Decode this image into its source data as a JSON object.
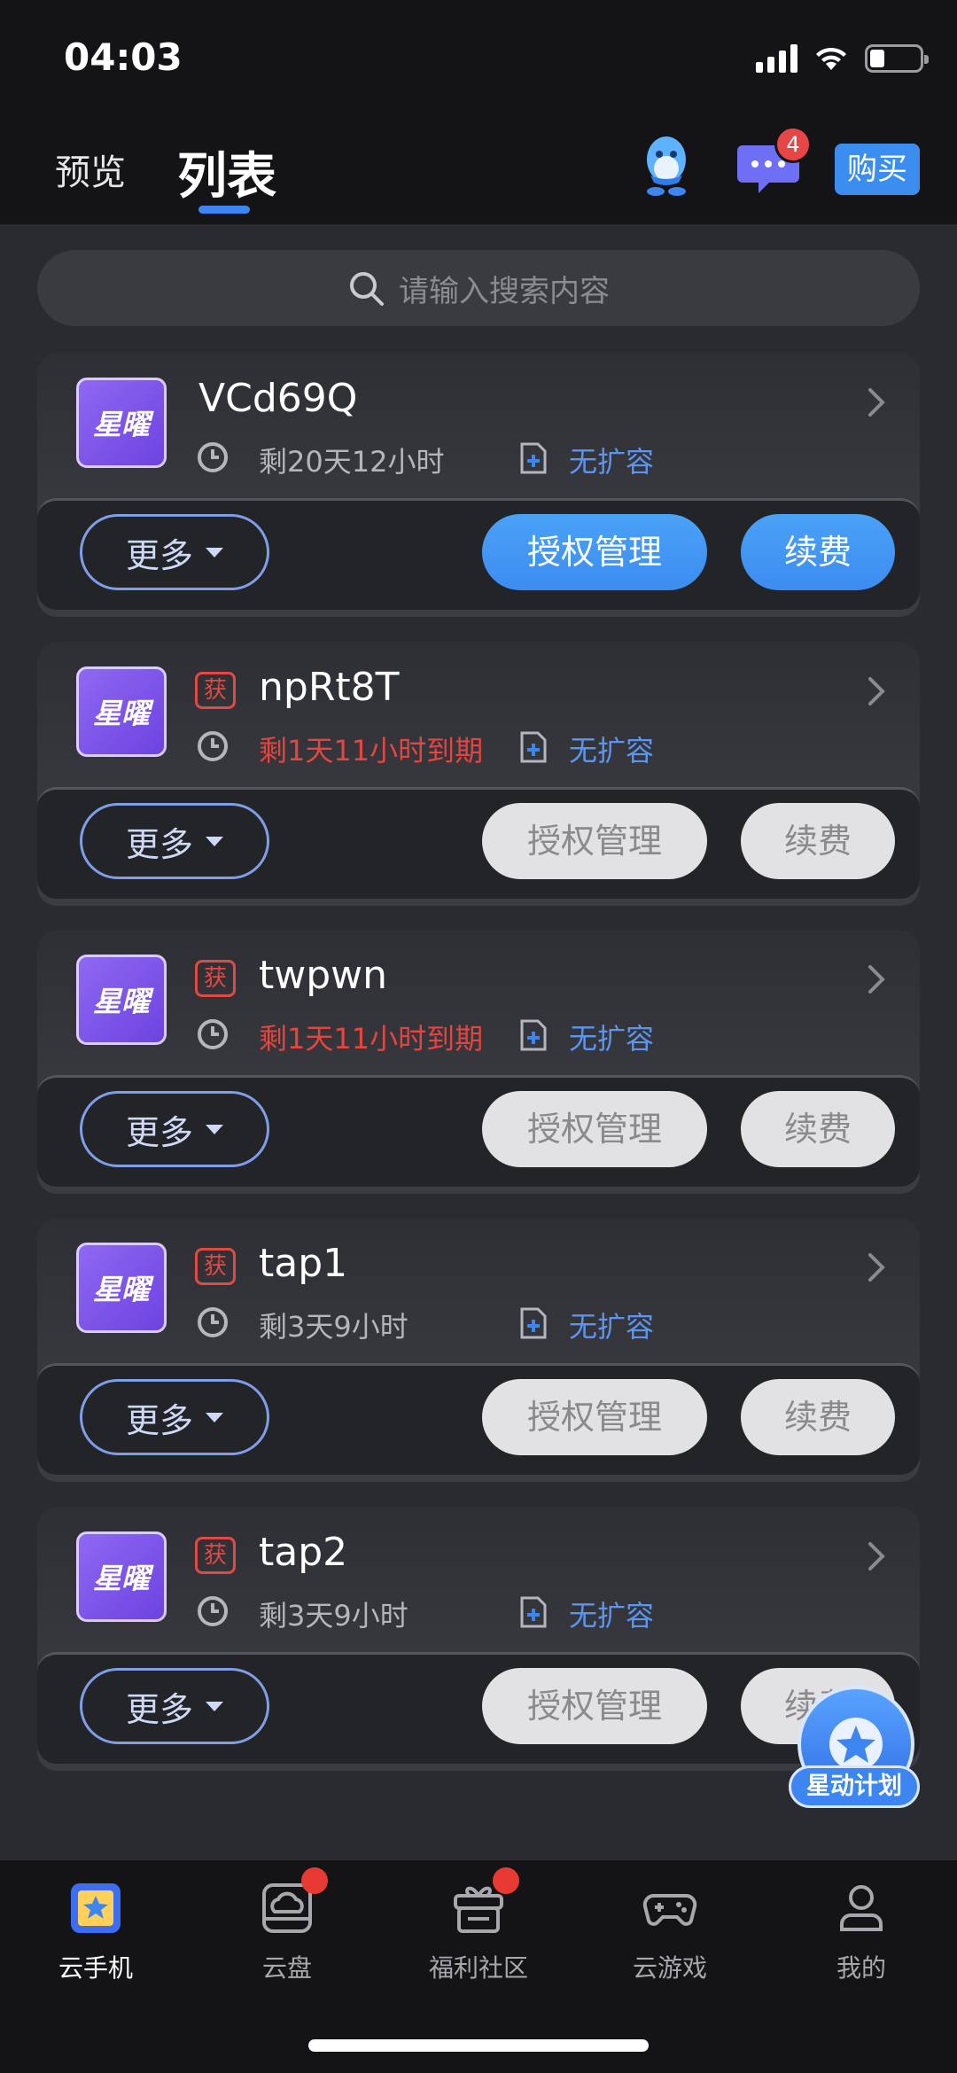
{
  "status_bar": {
    "time": "04:03"
  },
  "header": {
    "tab_preview": "预览",
    "tab_list": "列表",
    "message_count": "4",
    "buy_label": "购买"
  },
  "search": {
    "placeholder": "请输入搜索内容"
  },
  "devices": [
    {
      "logo": "星曜",
      "name": "VCd69Q",
      "tag": "",
      "remaining": "剩20天12小时",
      "expiring": false,
      "expansion": "无扩容",
      "more": "更多",
      "auth": "授权管理",
      "renew": "续费",
      "active": true
    },
    {
      "logo": "星曜",
      "name": "npRt8T",
      "tag": "获",
      "remaining": "剩1天11小时到期",
      "expiring": true,
      "expansion": "无扩容",
      "more": "更多",
      "auth": "授权管理",
      "renew": "续费",
      "active": false
    },
    {
      "logo": "星曜",
      "name": "twpwn",
      "tag": "获",
      "remaining": "剩1天11小时到期",
      "expiring": true,
      "expansion": "无扩容",
      "more": "更多",
      "auth": "授权管理",
      "renew": "续费",
      "active": false
    },
    {
      "logo": "星曜",
      "name": "tap1",
      "tag": "获",
      "remaining": "剩3天9小时",
      "expiring": false,
      "expansion": "无扩容",
      "more": "更多",
      "auth": "授权管理",
      "renew": "续费",
      "active": false
    },
    {
      "logo": "星曜",
      "name": "tap2",
      "tag": "获",
      "remaining": "剩3天9小时",
      "expiring": false,
      "expansion": "无扩容",
      "more": "更多",
      "auth": "授权管理",
      "renew": "续费",
      "active": false
    }
  ],
  "floating_badge": {
    "label": "星动计划"
  },
  "bottom_nav": [
    {
      "label": "云手机",
      "icon": "cloud-phone-icon",
      "active": true,
      "dot": false
    },
    {
      "label": "云盘",
      "icon": "cloud-disk-icon",
      "active": false,
      "dot": true
    },
    {
      "label": "福利社区",
      "icon": "gift-icon",
      "active": false,
      "dot": true
    },
    {
      "label": "云游戏",
      "icon": "gamepad-icon",
      "active": false,
      "dot": false
    },
    {
      "label": "我的",
      "icon": "profile-icon",
      "active": false,
      "dot": false
    }
  ],
  "colors": {
    "accent": "#3d86f2",
    "warning": "#e5453f",
    "background": "#2a2b30"
  }
}
